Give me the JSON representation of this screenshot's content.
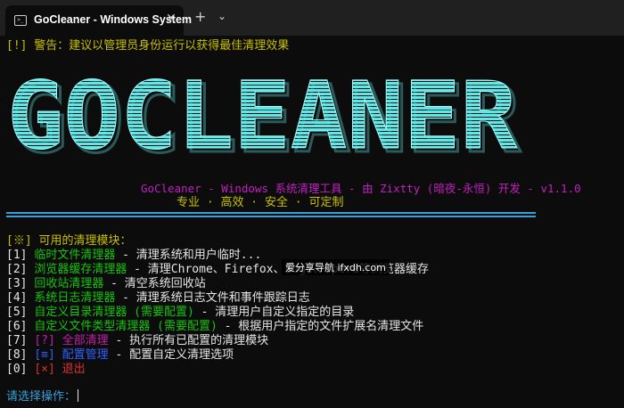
{
  "window": {
    "tab_title": "GoCleaner - Windows System",
    "tab_icon": "terminal-icon",
    "close_glyph": "✕",
    "new_tab_glyph": "+",
    "dropdown_glyph": "⌄"
  },
  "terminal": {
    "warning": "[!] 警告：建议以管理员身份运行以获得最佳清理效果",
    "logo_text": "GOCLEANER",
    "subtitle": "GoCleaner - Windows 系统清理工具 - 由 Zixtty (暗夜-永恒) 开发 - v1.1.0",
    "tagline": "专业 · 高效 · 安全 · 可定制",
    "menu_header": {
      "marker": "[※]",
      "text": " 可用的清理模块："
    },
    "menu": [
      {
        "num": "[1]",
        "name": "临时文件清理器",
        "desc": " - 清理系统和用户临时..."
      },
      {
        "num": "[2]",
        "name": "浏览器缓存清理器",
        "desc": " - 清理Chrome、Firefox、Edge、Opera等浏览器缓存"
      },
      {
        "num": "[3]",
        "name": "回收站清理器",
        "desc": " - 清空系统回收站"
      },
      {
        "num": "[4]",
        "name": "系统日志清理器",
        "desc": " - 清理系统日志文件和事件跟踪日志"
      },
      {
        "num": "[5]",
        "name": "自定义目录清理器 (需要配置)",
        "desc": " - 清理用户自定义指定的目录"
      },
      {
        "num": "[6]",
        "name": "自定义文件类型清理器 (需要配置)",
        "desc": " - 根据用户指定的文件扩展名清理文件"
      },
      {
        "num": "[7]",
        "name": "[?] 全部清理",
        "desc": " - 执行所有已配置的清理模块"
      },
      {
        "num": "[8]",
        "name": "[≡] 配置管理",
        "desc": " - 配置自定义清理选项"
      },
      {
        "num": "[0]",
        "name": "[×] 退出",
        "desc": ""
      }
    ],
    "prompt": "请选择操作："
  },
  "watermark": "爱分享导航 ifxdh.com",
  "colors": {
    "background": "#0c0c0c",
    "logo_fill": "#5fe8e8",
    "logo_shadow": "#2a5a5a",
    "warning": "#c8c000",
    "subtitle": "#c020c0",
    "module_name": "#16c60c",
    "rule": "#3aa0d8"
  }
}
